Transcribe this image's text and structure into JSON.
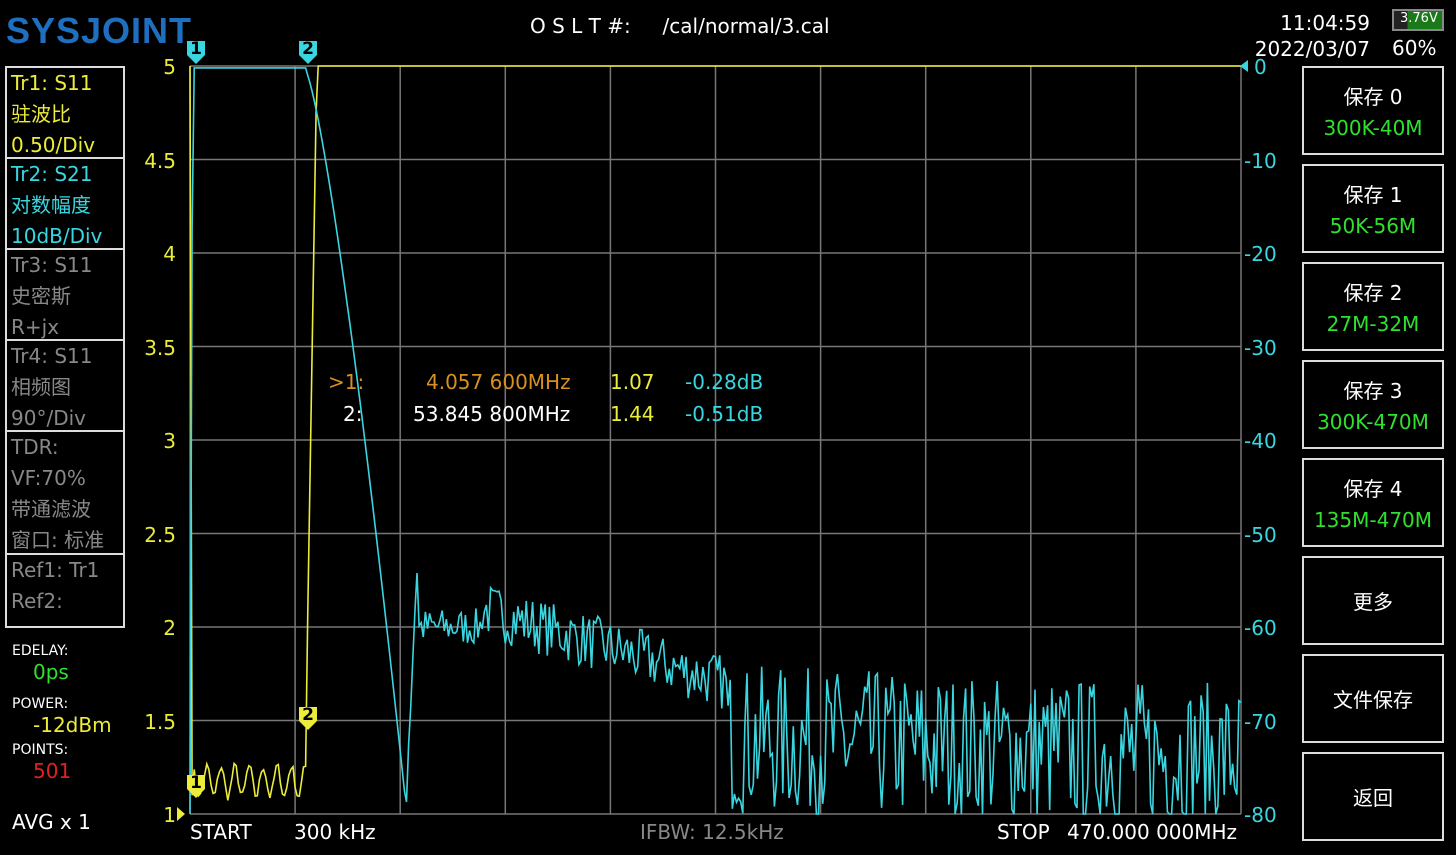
{
  "header": {
    "logo": "SYSJOINT",
    "cal_label": "O S L T #:",
    "cal_file": "/cal/normal/3.cal",
    "time": "11:04:59",
    "date": "2022/03/07",
    "battery_voltage": "3.76V",
    "battery_percent": "60%"
  },
  "traces": [
    {
      "line1": "Tr1:   S11",
      "line2": "驻波比",
      "line3": "0.50/Div"
    },
    {
      "line1": "Tr2:   S21",
      "line2": "对数幅度",
      "line3": "10dB/Div"
    },
    {
      "line1": "Tr3:   S11",
      "line2": "史密斯",
      "line3": "R+jx"
    },
    {
      "line1": "Tr4:   S11",
      "line2": "相频图",
      "line3": "90°/Div"
    }
  ],
  "tdr": {
    "line1": "TDR:",
    "line2": "VF:70%",
    "line3": "带通滤波",
    "line4": "窗口: 标准"
  },
  "refs": {
    "ref1": "Ref1:  Tr1",
    "ref2": "Ref2:"
  },
  "status": {
    "edelay_label": "EDELAY:",
    "edelay": "0ps",
    "power_label": "POWER:",
    "power": "-12dBm",
    "points_label": "POINTS:",
    "points": "501",
    "avg": "AVG x 1"
  },
  "left_axis": [
    "5",
    "4.5",
    "4",
    "3.5",
    "3",
    "2.5",
    "2",
    "1.5",
    "1"
  ],
  "right_axis": [
    "0",
    "-10",
    "-20",
    "-30",
    "-40",
    "-50",
    "-60",
    "-70",
    "-80"
  ],
  "markers": [
    {
      "id": ">1:",
      "freq": "4.057 600MHz",
      "swr": "1.07",
      "db": "-0.28dB"
    },
    {
      "id": "2:",
      "freq": "53.845 800MHz",
      "swr": "1.44",
      "db": "-0.51dB"
    }
  ],
  "marker_flags": [
    "1",
    "2"
  ],
  "footer": {
    "start_label": "START",
    "start": "300 kHz",
    "ifbw": "IFBW: 12.5kHz",
    "stop_label": "STOP",
    "stop": "470.000 000MHz"
  },
  "buttons": [
    {
      "label": "保存 0",
      "sub": "300K-40M"
    },
    {
      "label": "保存 1",
      "sub": "50K-56M"
    },
    {
      "label": "保存 2",
      "sub": "27M-32M"
    },
    {
      "label": "保存 3",
      "sub": "300K-470M"
    },
    {
      "label": "保存 4",
      "sub": "135M-470M"
    },
    {
      "label": "更多"
    },
    {
      "label": "文件保存"
    },
    {
      "label": "返回"
    }
  ],
  "colors": {
    "tr1": "#ecec3a",
    "tr2": "#3ad6e0",
    "grid": "#777777",
    "marker_active": "#d89020"
  }
}
